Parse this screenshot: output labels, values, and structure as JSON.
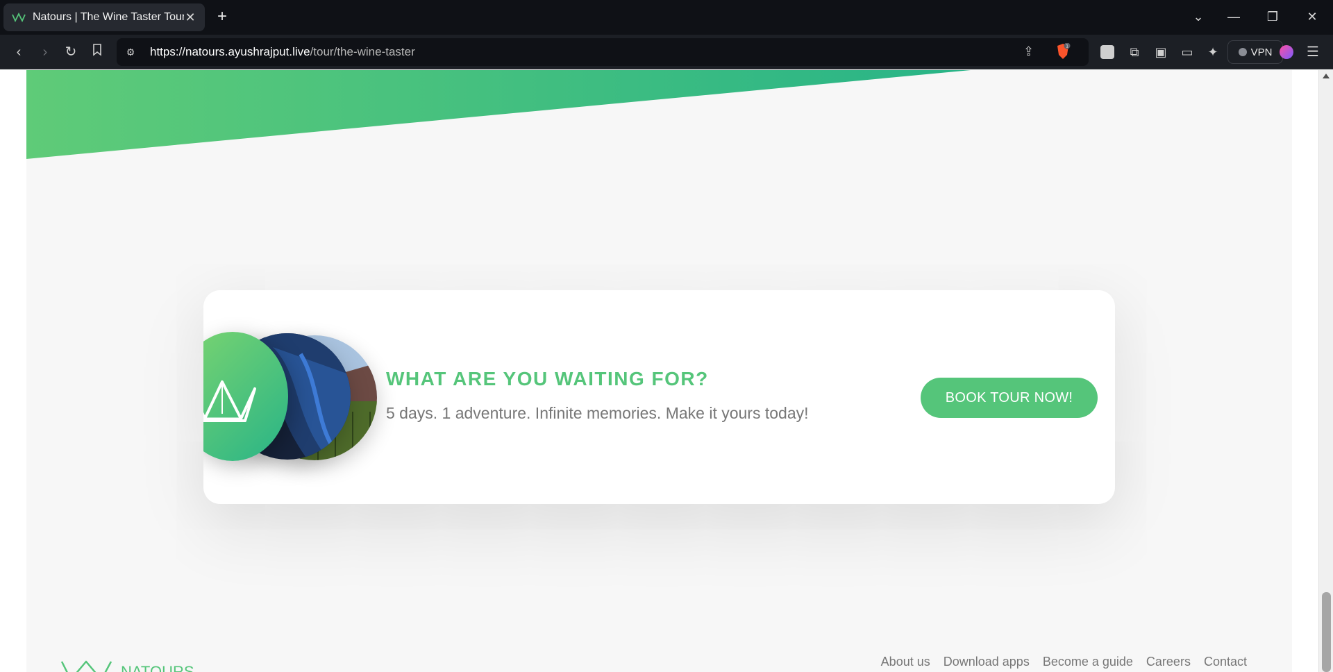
{
  "browser": {
    "tab_title": "Natours | The Wine Taster Tour",
    "url_host": "https://natours.ayushrajput.live",
    "url_path": "/tour/the-wine-taster",
    "vpn_label": "VPN",
    "brave_badge": "1"
  },
  "cta": {
    "heading": "WHAT ARE YOU WAITING FOR?",
    "text": "5 days. 1 adventure. Infinite memories. Make it yours today!",
    "button_label": "BOOK TOUR NOW!"
  },
  "footer": {
    "logo_text": "NATOURS",
    "nav": [
      "About us",
      "Download apps",
      "Become a guide",
      "Careers",
      "Contact"
    ]
  },
  "colors": {
    "brand_green": "#55c57a",
    "brand_green_dark": "#28b487",
    "brand_green_light": "#7dd56f"
  }
}
